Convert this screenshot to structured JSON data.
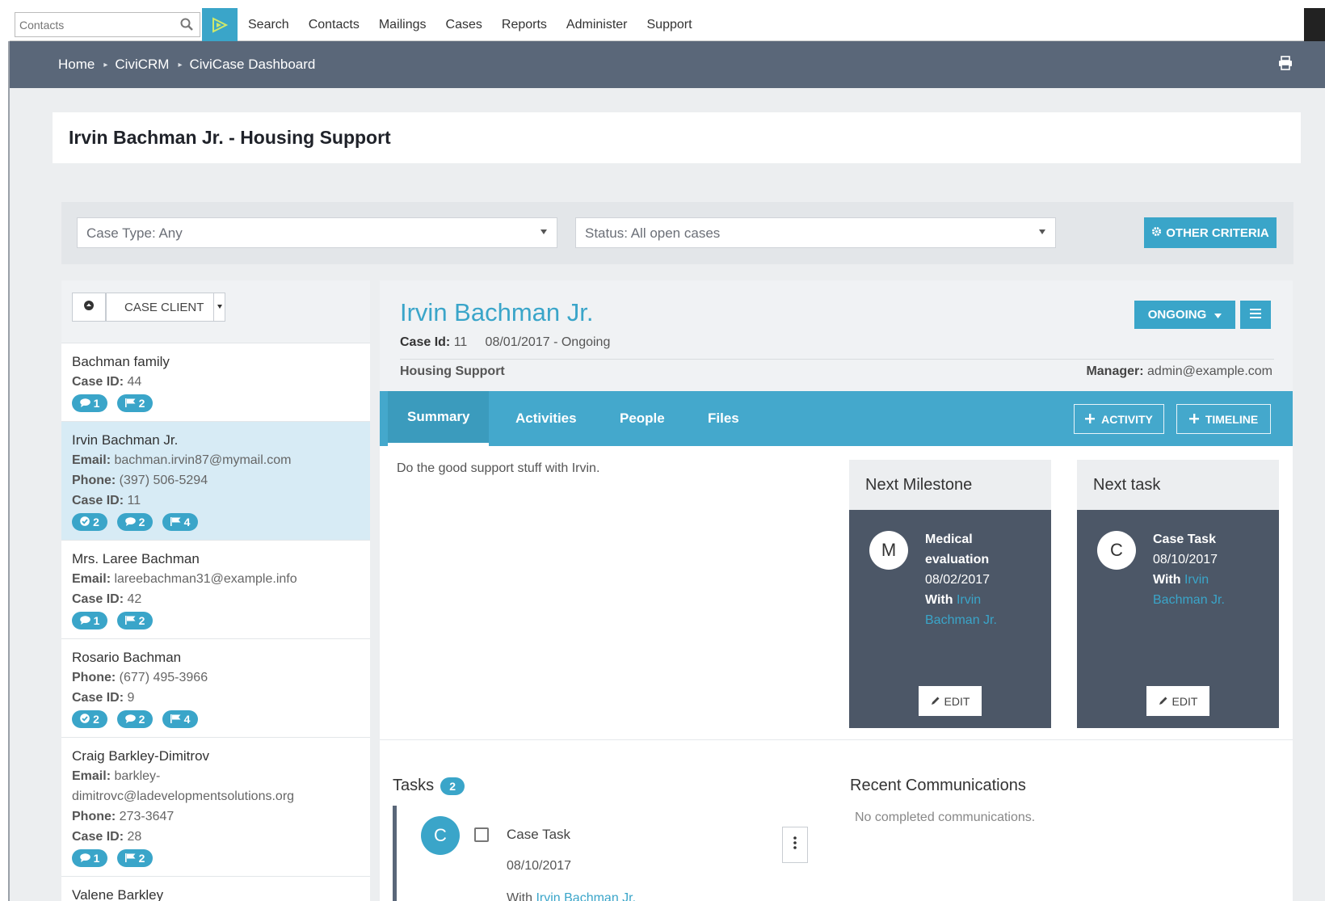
{
  "menubar": {
    "quicksearch_placeholder": "Contacts",
    "items": [
      "Search",
      "Contacts",
      "Mailings",
      "Cases",
      "Reports",
      "Administer",
      "Support"
    ]
  },
  "breadcrumb": [
    "Home",
    "CiviCRM",
    "CiviCase Dashboard"
  ],
  "page_title": "Irvin Bachman Jr. - Housing Support",
  "filters": {
    "case_type": "Case Type: Any",
    "status": "Status: All open cases",
    "other_criteria_label": "OTHER CRITERIA"
  },
  "case_list": {
    "sort_label": "CASE CLIENT",
    "items": [
      {
        "name": "Bachman family",
        "fields": [
          {
            "label": "Case ID:",
            "value": "44"
          }
        ],
        "badges": [
          {
            "icon": "comment-icon",
            "count": "1"
          },
          {
            "icon": "flag-icon",
            "count": "2"
          }
        ]
      },
      {
        "name": "Irvin Bachman Jr.",
        "fields": [
          {
            "label": "Email:",
            "value": "bachman.irvin87@mymail.com"
          },
          {
            "label": "Phone:",
            "value": "(397) 506-5294"
          },
          {
            "label": "Case ID:",
            "value": "11"
          }
        ],
        "badges": [
          {
            "icon": "check-icon",
            "count": "2"
          },
          {
            "icon": "comment-icon",
            "count": "2"
          },
          {
            "icon": "flag-icon",
            "count": "4"
          }
        ]
      },
      {
        "name": "Mrs. Laree Bachman",
        "fields": [
          {
            "label": "Email:",
            "value": "lareebachman31@example.info"
          },
          {
            "label": "Case ID:",
            "value": "42"
          }
        ],
        "badges": [
          {
            "icon": "comment-icon",
            "count": "1"
          },
          {
            "icon": "flag-icon",
            "count": "2"
          }
        ]
      },
      {
        "name": "Rosario Bachman",
        "fields": [
          {
            "label": "Phone:",
            "value": "(677) 495-3966"
          },
          {
            "label": "Case ID:",
            "value": "9"
          }
        ],
        "badges": [
          {
            "icon": "check-icon",
            "count": "2"
          },
          {
            "icon": "comment-icon",
            "count": "2"
          },
          {
            "icon": "flag-icon",
            "count": "4"
          }
        ]
      },
      {
        "name": "Craig Barkley-Dimitrov",
        "fields": [
          {
            "label": "Email:",
            "value": "barkley-dimitrovc@ladevelopmentsolutions.org"
          },
          {
            "label": "Phone:",
            "value": "273-3647"
          },
          {
            "label": "Case ID:",
            "value": "28"
          }
        ],
        "badges": [
          {
            "icon": "comment-icon",
            "count": "1"
          },
          {
            "icon": "flag-icon",
            "count": "2"
          }
        ]
      },
      {
        "name": "Valene Barkley",
        "fields": [],
        "badges": []
      }
    ]
  },
  "case_details": {
    "client_name": "Irvin Bachman Jr.",
    "case_id_label": "Case Id:",
    "case_id": "11",
    "start_status": "08/01/2017 - Ongoing",
    "case_type": "Housing Support",
    "manager_label": "Manager:",
    "manager": "admin@example.com",
    "status_button": "ONGOING",
    "tabs": [
      "Summary",
      "Activities",
      "People",
      "Files"
    ],
    "add_activity": "ACTIVITY",
    "add_timeline": "TIMELINE",
    "summary_text": "Do the good support stuff with Irvin.",
    "next_milestone": {
      "heading": "Next Milestone",
      "avatar": "M",
      "title": "Medical evaluation",
      "date": "08/02/2017",
      "with_label": "With",
      "with": "Irvin Bachman Jr.",
      "edit": "EDIT"
    },
    "next_task": {
      "heading": "Next task",
      "avatar": "C",
      "title": "Case Task",
      "date": "08/10/2017",
      "with_label": "With",
      "with": "Irvin Bachman Jr.",
      "edit": "EDIT"
    },
    "tasks": {
      "heading": "Tasks",
      "count": "2",
      "items": [
        {
          "avatar": "C",
          "name": "Case Task",
          "date": "08/10/2017",
          "with_label": "With",
          "with": "Irvin Bachman Jr."
        }
      ]
    },
    "recent_communications": {
      "heading": "Recent Communications",
      "empty": "No completed communications."
    }
  },
  "colors": {
    "accent": "#3aa5c9",
    "breadcrumb_bar": "#5a6779",
    "card_dark": "#4c5767",
    "active_row": "#d7ebf5"
  }
}
